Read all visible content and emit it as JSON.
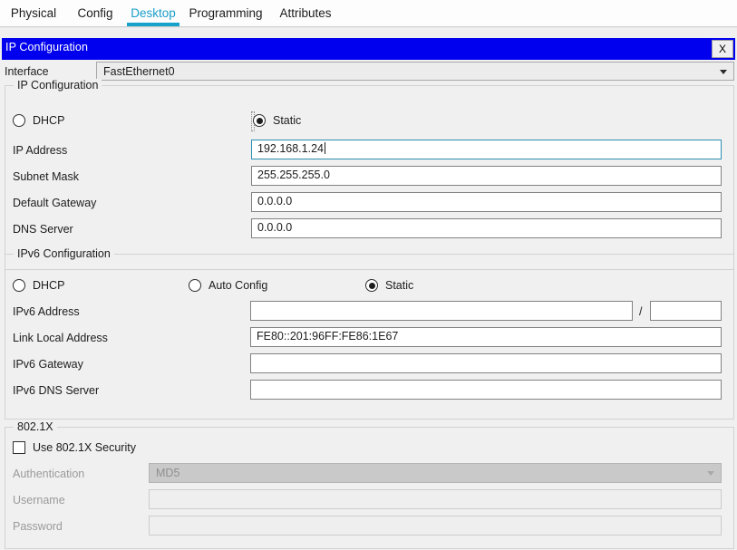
{
  "tabs": [
    {
      "label": "Physical",
      "active": false
    },
    {
      "label": "Config",
      "active": false
    },
    {
      "label": "Desktop",
      "active": true
    },
    {
      "label": "Programming",
      "active": false
    },
    {
      "label": "Attributes",
      "active": false
    }
  ],
  "window": {
    "title": "IP Configuration",
    "close_label": "X",
    "title_bg": "#0000ee",
    "accent": "#17a2cc"
  },
  "interface": {
    "label": "Interface",
    "value": "FastEthernet0"
  },
  "ipv4": {
    "legend": "IP Configuration",
    "dhcp_label": "DHCP",
    "static_label": "Static",
    "mode": "Static",
    "fields": [
      {
        "label": "IP Address",
        "value": "192.168.1.24",
        "focused": true
      },
      {
        "label": "Subnet Mask",
        "value": "255.255.255.0",
        "focused": false
      },
      {
        "label": "Default Gateway",
        "value": "0.0.0.0",
        "focused": false
      },
      {
        "label": "DNS Server",
        "value": "0.0.0.0",
        "focused": false
      }
    ]
  },
  "ipv6": {
    "legend": "IPv6 Configuration",
    "dhcp_label": "DHCP",
    "auto_config_label": "Auto Config",
    "static_label": "Static",
    "mode": "Static",
    "address_label": "IPv6 Address",
    "address_value": "",
    "prefix_separator": "/",
    "prefix_value": "",
    "link_local_label": "Link Local Address",
    "link_local_value": "FE80::201:96FF:FE86:1E67",
    "gateway_label": "IPv6 Gateway",
    "gateway_value": "",
    "dns_label": "IPv6 DNS Server",
    "dns_value": ""
  },
  "dot1x": {
    "legend": "802.1X",
    "use_security_label": "Use 802.1X Security",
    "use_security_checked": false,
    "authentication_label": "Authentication",
    "authentication_value": "MD5",
    "username_label": "Username",
    "username_value": "",
    "password_label": "Password",
    "password_value": ""
  }
}
